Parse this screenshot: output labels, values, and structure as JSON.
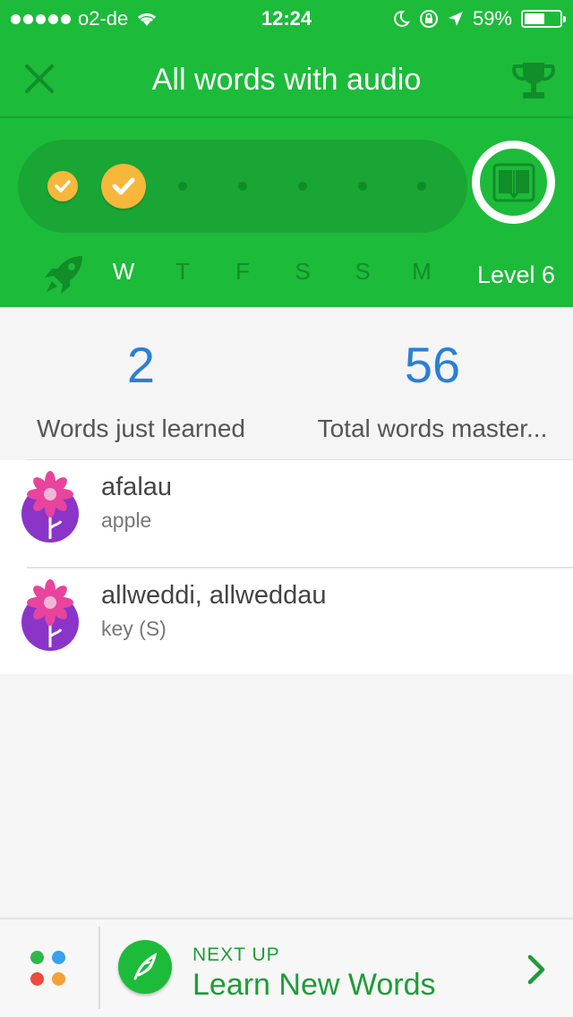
{
  "status_bar": {
    "carrier": "o2-de",
    "time": "12:24",
    "battery_percent": "59%",
    "battery_level": 0.59,
    "signal_bars": 5
  },
  "nav": {
    "title": "All words with audio"
  },
  "streak": {
    "days": [
      "W",
      "T",
      "F",
      "S",
      "S",
      "M"
    ],
    "active_day_index": 0,
    "level": "Level 6"
  },
  "stats": {
    "words_learned_value": "2",
    "words_learned_label": "Words just learned",
    "total_mastered_value": "56",
    "total_mastered_label": "Total words master..."
  },
  "words": [
    {
      "word": "afalau",
      "meaning": "apple"
    },
    {
      "word": "allweddi, allweddau",
      "meaning": "key (S)"
    }
  ],
  "bottom": {
    "next_label": "NEXT UP",
    "next_title": "Learn New Words"
  },
  "colors": {
    "brand_green": "#1dbb3a",
    "stat_blue": "#2a7fd6",
    "check_gold": "#f6b73b",
    "menu_green": "#2fb84a",
    "menu_blue": "#3aa0f0",
    "menu_red": "#ef4b3c",
    "menu_orange": "#f7a035"
  }
}
